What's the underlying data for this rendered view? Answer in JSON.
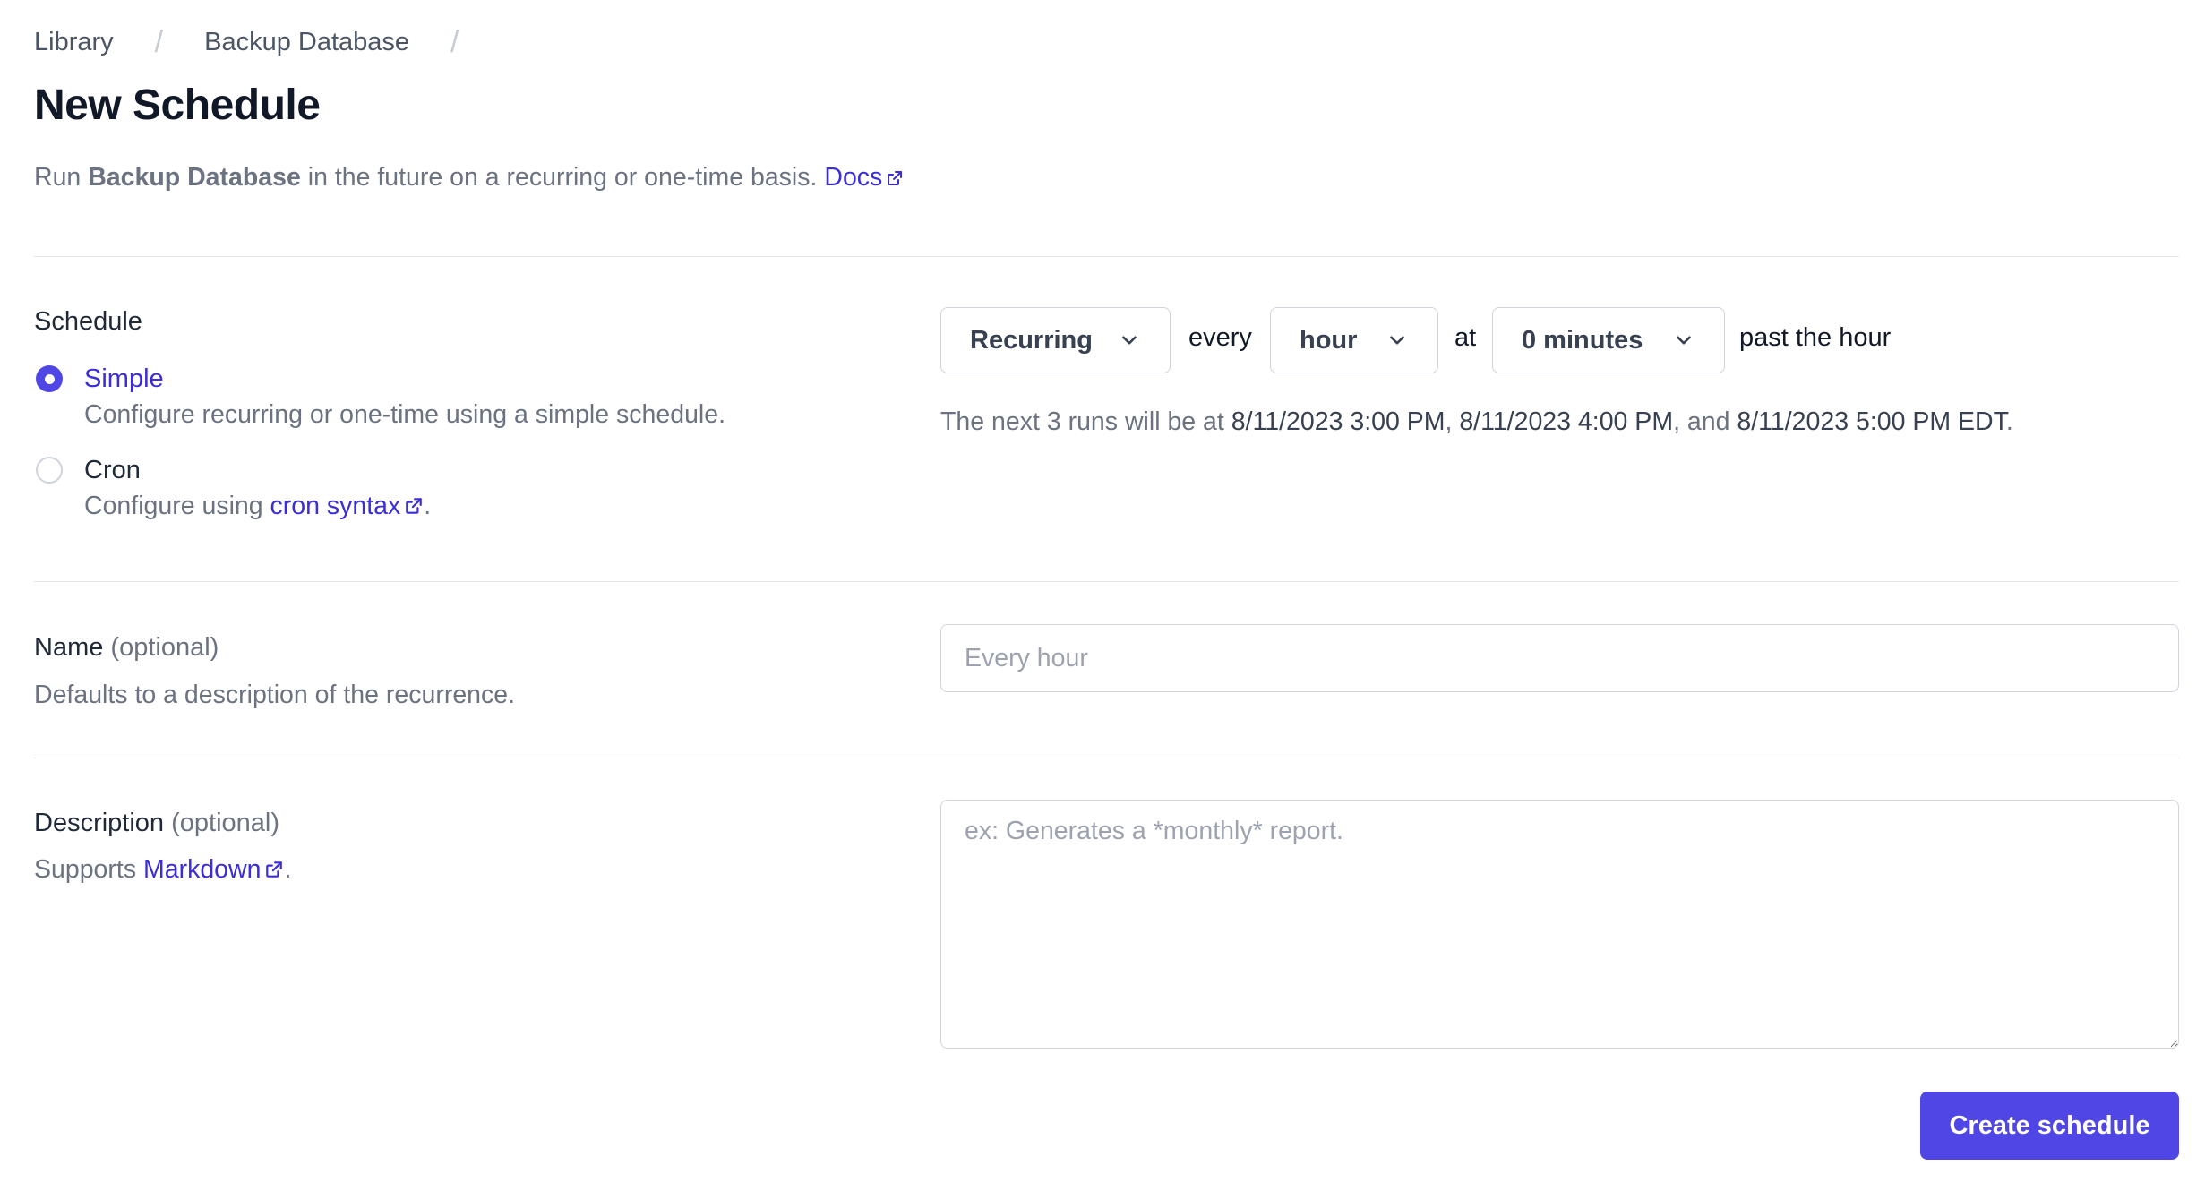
{
  "breadcrumb": {
    "items": [
      "Library",
      "Backup Database"
    ],
    "separator": "/"
  },
  "page": {
    "title": "New Schedule",
    "subtitle_prefix": "Run ",
    "subtitle_bold": "Backup Database",
    "subtitle_suffix": " in the future on a recurring or one-time basis. ",
    "docs_link": "Docs"
  },
  "schedule": {
    "label": "Schedule",
    "options": [
      {
        "title": "Simple",
        "selected": true,
        "description": "Configure recurring or one-time using a simple schedule."
      },
      {
        "title": "Cron",
        "selected": false,
        "description_prefix": "Configure using ",
        "description_link": "cron syntax",
        "description_suffix": "."
      }
    ],
    "type_select": "Recurring",
    "word_every": "every",
    "interval_select": "hour",
    "word_at": "at",
    "minute_select": "0 minutes",
    "word_past": "past the hour",
    "next_runs": {
      "prefix": "The next 3 runs will be at ",
      "run1": "8/11/2023 3:00 PM",
      "sep1": ", ",
      "run2": "8/11/2023 4:00 PM",
      "sep2": ", and ",
      "run3": "8/11/2023 5:00 PM EDT",
      "suffix": "."
    }
  },
  "name_field": {
    "label": "Name",
    "optional": "(optional)",
    "helper": "Defaults to a description of the recurrence.",
    "placeholder": "Every hour",
    "value": ""
  },
  "description_field": {
    "label": "Description",
    "optional": "(optional)",
    "helper_prefix": "Supports ",
    "helper_link": "Markdown",
    "helper_suffix": ".",
    "placeholder": "ex: Generates a *monthly* report.",
    "value": ""
  },
  "actions": {
    "create_label": "Create schedule"
  },
  "colors": {
    "accent": "#4f46e5",
    "link": "#3b2ed8",
    "muted_text": "#6b7280",
    "border": "#d1d5db"
  },
  "icons": {
    "external_link": "external-link-icon",
    "chevron": "chevron-down-icon"
  }
}
